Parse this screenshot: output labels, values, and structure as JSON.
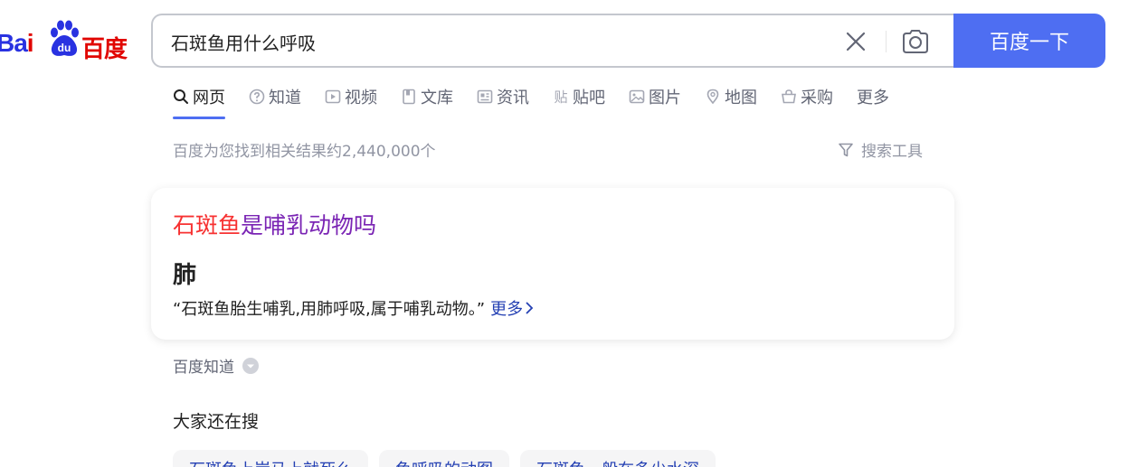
{
  "logo": {
    "text_bai": "Ba",
    "text_i": "i",
    "paw_text": "du",
    "text_cn": "百度"
  },
  "search": {
    "query": "石斑鱼用什么呼吸",
    "button_label": "百度一下",
    "clear_icon": "close-icon",
    "camera_icon": "camera-icon"
  },
  "tabs": [
    {
      "label": "网页",
      "icon": "search-icon",
      "active": true
    },
    {
      "label": "知道",
      "icon": "question-icon"
    },
    {
      "label": "视频",
      "icon": "play-icon"
    },
    {
      "label": "文库",
      "icon": "document-icon"
    },
    {
      "label": "资讯",
      "icon": "news-icon"
    },
    {
      "label": "贴吧",
      "icon": "tieba-icon"
    },
    {
      "label": "图片",
      "icon": "image-icon"
    },
    {
      "label": "地图",
      "icon": "map-pin-icon"
    },
    {
      "label": "采购",
      "icon": "basket-icon"
    },
    {
      "label": "更多"
    }
  ],
  "results": {
    "count_text": "百度为您找到相关结果约2,440,000个",
    "tools_label": "搜索工具"
  },
  "answer_card": {
    "title_highlight": "石斑鱼",
    "title_rest": "是哺乳动物吗",
    "answer": "肺",
    "quote": "“石斑鱼胎生哺乳,用肺呼吸,属于哺乳动物。”",
    "more_label": "更多"
  },
  "source": {
    "label": "百度知道"
  },
  "also_search": {
    "title": "大家还在搜",
    "items": [
      "石斑鱼上岸马上就死么",
      "鱼呼吸的动图",
      "石斑鱼一般在多少水深"
    ]
  },
  "colors": {
    "accent": "#4e6ef2",
    "title_purple": "#7a24b4",
    "highlight_red": "#f73131",
    "link_blue": "#2440b3",
    "muted": "#9195a3"
  }
}
